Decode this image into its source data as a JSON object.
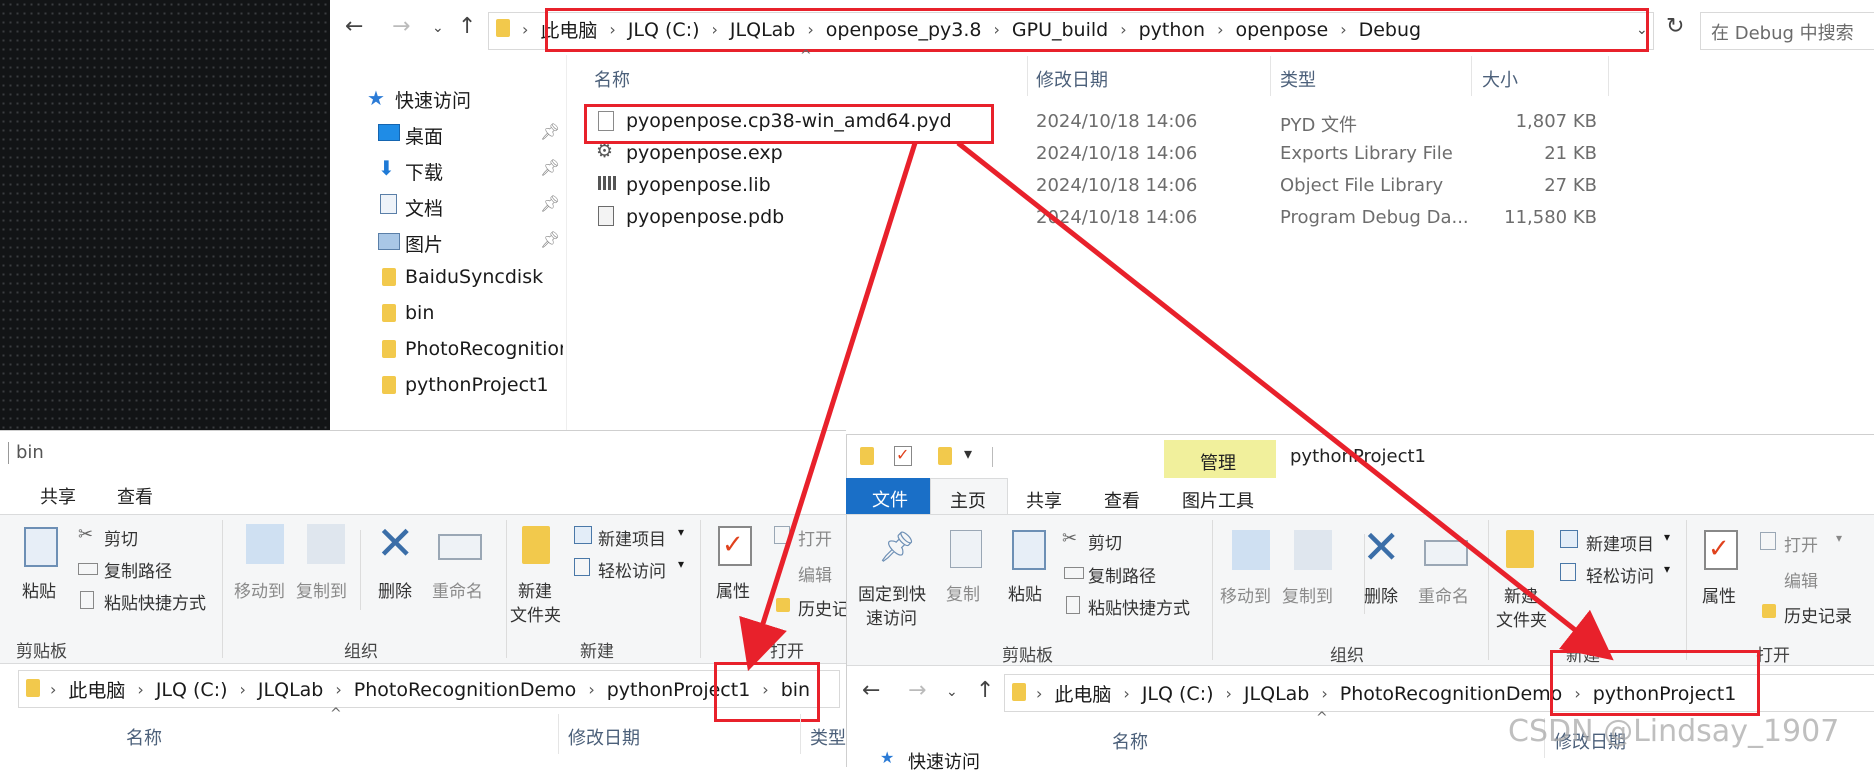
{
  "top_window": {
    "address_crumbs": [
      "此电脑",
      "JLQ (C:)",
      "JLQLab",
      "openpose_py3.8",
      "GPU_build",
      "python",
      "openpose",
      "Debug"
    ],
    "search_placeholder": "在 Debug 中搜索",
    "nav_pane": {
      "quick_access": "快速访问",
      "items": [
        {
          "label": "桌面",
          "icon": "desktop-icon",
          "pinned": true
        },
        {
          "label": "下载",
          "icon": "download-icon",
          "pinned": true
        },
        {
          "label": "文档",
          "icon": "document-icon",
          "pinned": true
        },
        {
          "label": "图片",
          "icon": "picture-icon",
          "pinned": true
        },
        {
          "label": "BaiduSyncdisk",
          "icon": "folder-icon",
          "pinned": false
        },
        {
          "label": "bin",
          "icon": "folder-icon",
          "pinned": false
        },
        {
          "label": "PhotoRecognition",
          "icon": "folder-icon",
          "pinned": false
        },
        {
          "label": "pythonProject1",
          "icon": "folder-icon",
          "pinned": false
        }
      ]
    },
    "columns": [
      "名称",
      "修改日期",
      "类型",
      "大小"
    ],
    "files": [
      {
        "name": "pyopenpose.cp38-win_amd64.pyd",
        "date": "2024/10/18 14:06",
        "type": "PYD 文件",
        "size": "1,807 KB",
        "icon": "file-icon"
      },
      {
        "name": "pyopenpose.exp",
        "date": "2024/10/18 14:06",
        "type": "Exports Library File",
        "size": "21 KB",
        "icon": "gear-file-icon"
      },
      {
        "name": "pyopenpose.lib",
        "date": "2024/10/18 14:06",
        "type": "Object File Library",
        "size": "27 KB",
        "icon": "library-file-icon"
      },
      {
        "name": "pyopenpose.pdb",
        "date": "2024/10/18 14:06",
        "type": "Program Debug Da...",
        "size": "11,580 KB",
        "icon": "debug-file-icon"
      }
    ]
  },
  "left_window": {
    "title": "bin",
    "tabs": [
      "共享",
      "查看"
    ],
    "ribbon": {
      "clipboard": {
        "paste": "粘贴",
        "cut": "剪切",
        "copy_path": "复制路径",
        "paste_shortcut": "粘贴快捷方式",
        "group": "剪贴板"
      },
      "organize": {
        "move_to": "移动到",
        "copy_to": "复制到",
        "delete": "删除",
        "rename": "重命名",
        "group": "组织"
      },
      "new": {
        "new_item": "新建项目",
        "easy_access": "轻松访问",
        "new_folder_1": "新建",
        "new_folder_2": "文件夹",
        "group": "新建"
      },
      "open": {
        "properties": "属性",
        "open": "打开",
        "edit": "编辑",
        "history": "历史记",
        "group": "打开"
      }
    },
    "address_crumbs": [
      "此电脑",
      "JLQ (C:)",
      "JLQLab",
      "PhotoRecognitionDemo",
      "pythonProject1",
      "bin"
    ],
    "columns": [
      "名称",
      "修改日期",
      "类型"
    ]
  },
  "right_window": {
    "title": "pythonProject1",
    "context_tab": "管理",
    "tabs": [
      "文件",
      "主页",
      "共享",
      "查看",
      "图片工具"
    ],
    "ribbon": {
      "pin": {
        "line1": "固定到快",
        "line2": "速访问"
      },
      "clipboard": {
        "copy": "复制",
        "paste": "粘贴",
        "cut": "剪切",
        "copy_path": "复制路径",
        "paste_shortcut": "粘贴快捷方式",
        "group": "剪贴板"
      },
      "organize": {
        "move_to": "移动到",
        "copy_to": "复制到",
        "delete": "删除",
        "rename": "重命名",
        "group": "组织"
      },
      "new": {
        "new_item": "新建项目",
        "easy_access": "轻松访问",
        "new_folder_1": "新建",
        "new_folder_2": "文件夹",
        "group": "新建"
      },
      "open": {
        "properties": "属性",
        "open": "打开",
        "edit": "编辑",
        "history": "历史记录",
        "group": "打开"
      }
    },
    "address_crumbs": [
      "此电脑",
      "JLQ (C:)",
      "JLQLab",
      "PhotoRecognitionDemo",
      "pythonProject1"
    ],
    "columns": [
      "名称",
      "修改日期"
    ],
    "nav_quick_access": "快速访问"
  },
  "annotations": {
    "color": "#e8212b"
  },
  "watermark": "CSDN @Lindsay_1907"
}
